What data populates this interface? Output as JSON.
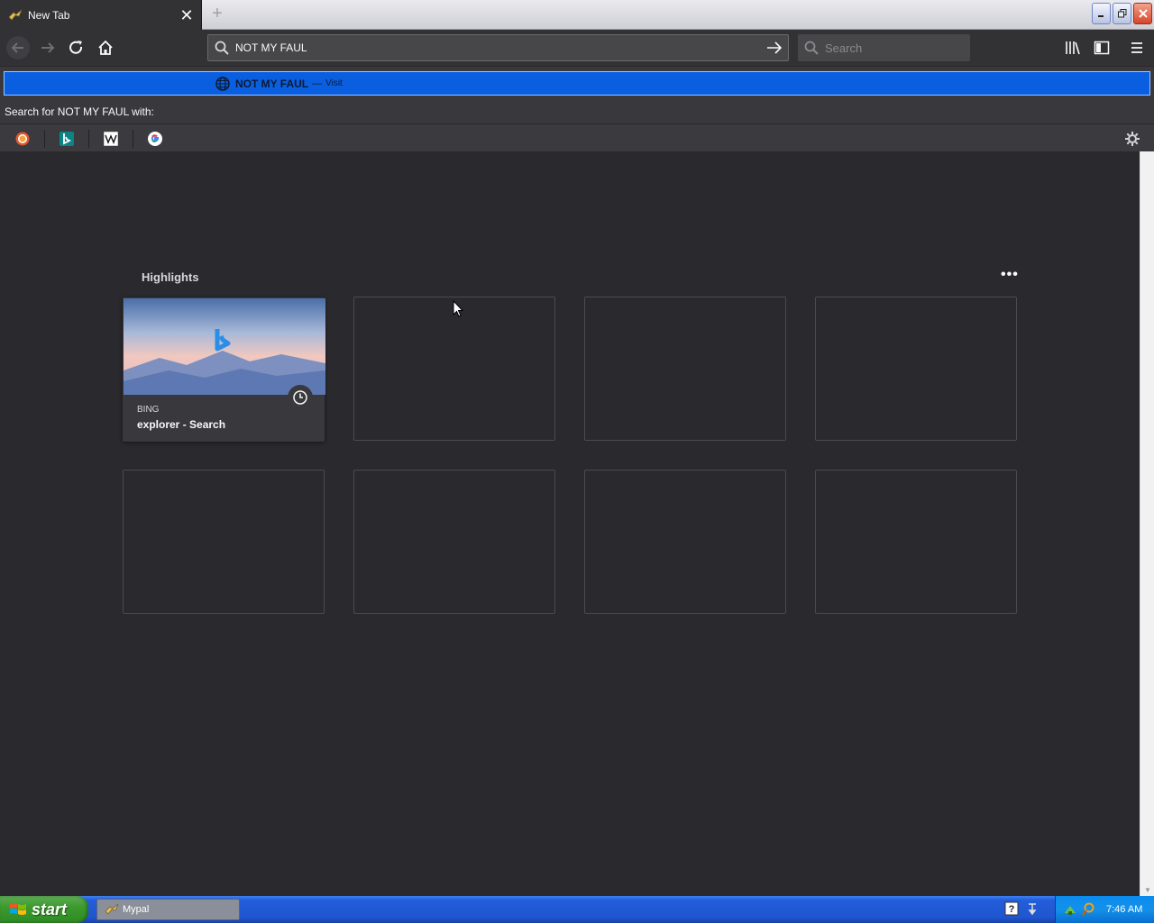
{
  "browser": {
    "tab": {
      "title": "New Tab",
      "close": "✕"
    },
    "new_tab": "+",
    "url_value": "NOT MY FAUL",
    "search_placeholder": "Search"
  },
  "autocomplete": {
    "selected": {
      "title": "NOT MY FAUL",
      "dash": "—",
      "action": "Visit"
    },
    "search_with_label": "Search for NOT MY FAUL with:",
    "engines": [
      "duckduckgo-icon",
      "bing-icon",
      "wikipedia-icon",
      "google-icon"
    ]
  },
  "highlights": {
    "title": "Highlights",
    "more": "•••",
    "cards": [
      {
        "host": "BING",
        "title": "explorer - Search"
      }
    ]
  },
  "taskbar": {
    "start_label": "start",
    "task_label": "Mypal",
    "clock": "7:46 AM"
  },
  "colors": {
    "accent_selected_row": "#0a5fe0",
    "page_background": "#2a2a2e",
    "toolbar": "#323234"
  }
}
